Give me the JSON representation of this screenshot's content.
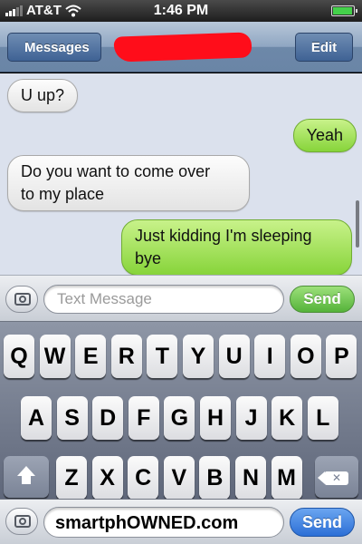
{
  "status_bar": {
    "carrier": "AT&T",
    "time": "1:46 PM",
    "signal_icon": "signal-bars-icon",
    "wifi_icon": "wifi-icon",
    "battery_icon": "battery-icon",
    "battery_level": 1.0
  },
  "nav": {
    "back_label": "Messages",
    "edit_label": "Edit",
    "contact_redaction_color": "#ff0d1a"
  },
  "messages": [
    {
      "from": "them",
      "text": "U up?"
    },
    {
      "from": "me",
      "text": "Yeah"
    },
    {
      "from": "them",
      "line1": "Do you want to come over",
      "line2": "to my place"
    },
    {
      "from": "me",
      "line1": "Just kidding I'm sleeping",
      "line2": "bye"
    }
  ],
  "composer": {
    "placeholder": "Text Message",
    "send_label": "Send",
    "camera_icon": "camera-icon"
  },
  "keyboard": {
    "row1": [
      "Q",
      "W",
      "E",
      "R",
      "T",
      "Y",
      "U",
      "I",
      "O",
      "P"
    ],
    "row2": [
      "A",
      "S",
      "D",
      "F",
      "G",
      "H",
      "J",
      "K",
      "L"
    ],
    "row3": [
      "Z",
      "X",
      "C",
      "V",
      "B",
      "N",
      "M"
    ],
    "shift_icon": "shift-icon",
    "backspace_icon": "backspace-icon"
  },
  "watermark": {
    "text": "smartphOWNED.com",
    "send_label": "Send"
  },
  "colors": {
    "incoming_bubble": "#e3e3e3",
    "outgoing_bubble": "#87d43a",
    "send_green": "#55b33a",
    "send_blue": "#2c6fd6"
  }
}
